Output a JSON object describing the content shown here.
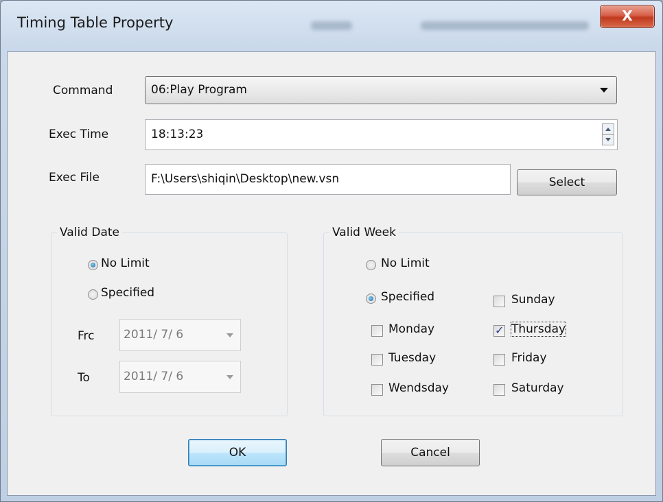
{
  "window": {
    "title": "Timing Table Property",
    "close_label": "X"
  },
  "command": {
    "label": "Command",
    "value": "06:Play Program"
  },
  "exec_time": {
    "label": "Exec Time",
    "value": "18:13:23"
  },
  "exec_file": {
    "label": "Exec File",
    "value": "F:\\Users\\shiqin\\Desktop\\new.vsn",
    "select_label": "Select"
  },
  "valid_date": {
    "title": "Valid Date",
    "no_limit_label": "No Limit",
    "specified_label": "Specified",
    "selected": "no_limit",
    "from_label": "Frc",
    "from_value": "2011/ 7/ 6",
    "to_label": "To",
    "to_value": "2011/ 7/ 6"
  },
  "valid_week": {
    "title": "Valid Week",
    "no_limit_label": "No Limit",
    "specified_label": "Specified",
    "selected": "specified",
    "days": [
      {
        "label": "Sunday",
        "checked": false
      },
      {
        "label": "Monday",
        "checked": false
      },
      {
        "label": "Tuesday",
        "checked": false
      },
      {
        "label": "Wendsday",
        "checked": false
      },
      {
        "label": "Thursday",
        "checked": true
      },
      {
        "label": "Friday",
        "checked": false
      },
      {
        "label": "Saturday",
        "checked": false
      }
    ]
  },
  "buttons": {
    "ok_label": "OK",
    "cancel_label": "Cancel"
  },
  "colors": {
    "title_bar": "#c9d8ea",
    "close_button": "#c0391e",
    "dialog_bg": "#f0f0f0",
    "default_button": "#bee6fd"
  }
}
